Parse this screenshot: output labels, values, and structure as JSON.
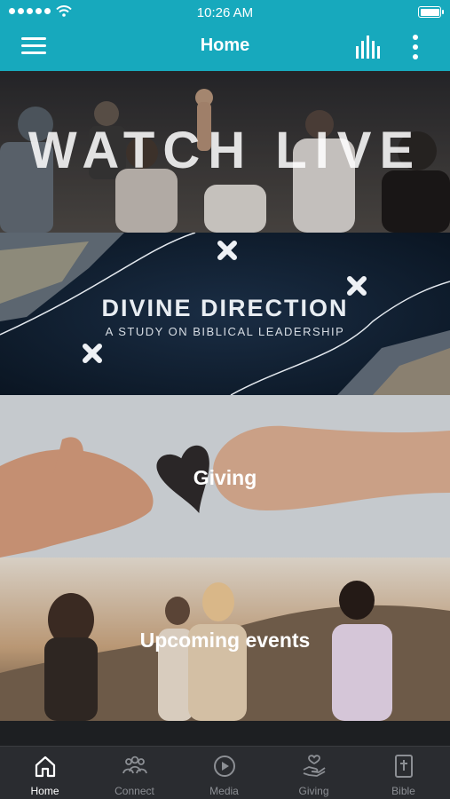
{
  "status_bar": {
    "time": "10:26 AM"
  },
  "header": {
    "title": "Home"
  },
  "tiles": [
    {
      "id": "watch-live",
      "label": "WATCH LIVE"
    },
    {
      "id": "divine-direction",
      "label": "DIVINE DIRECTION",
      "subtitle": "A STUDY ON BIBLICAL LEADERSHIP"
    },
    {
      "id": "giving",
      "label": "Giving"
    },
    {
      "id": "upcoming-events",
      "label": "Upcoming events"
    }
  ],
  "tabbar": {
    "active": "Home",
    "items": [
      {
        "label": "Home",
        "icon": "home-icon"
      },
      {
        "label": "Connect",
        "icon": "people-icon"
      },
      {
        "label": "Media",
        "icon": "play-icon"
      },
      {
        "label": "Giving",
        "icon": "hand-heart-icon"
      },
      {
        "label": "Bible",
        "icon": "bible-icon"
      }
    ]
  },
  "colors": {
    "accent": "#17a9bd",
    "tabbar_bg": "#2a2c30"
  }
}
